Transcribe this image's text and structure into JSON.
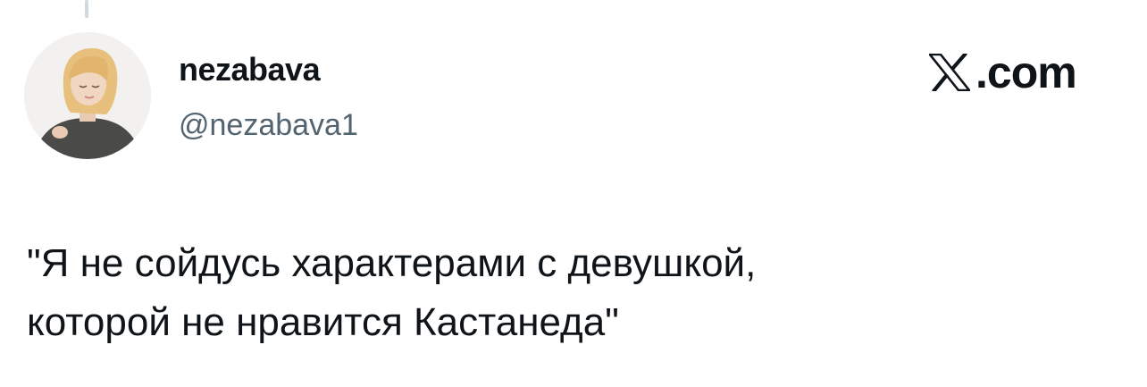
{
  "author": {
    "display_name": "nezabava",
    "handle": "@nezabava1",
    "avatar_icon": "avatar-photo"
  },
  "brand": {
    "name": "x-logo",
    "domain_label": ".com"
  },
  "tweet": {
    "lines": [
      "\"Я не сойдусь характерами с девушкой,",
      "которой не нравится Кастанеда\""
    ]
  },
  "colors": {
    "text": "#0f1419",
    "secondary": "#536471",
    "background": "#ffffff",
    "thread_line": "#cfd9de"
  }
}
